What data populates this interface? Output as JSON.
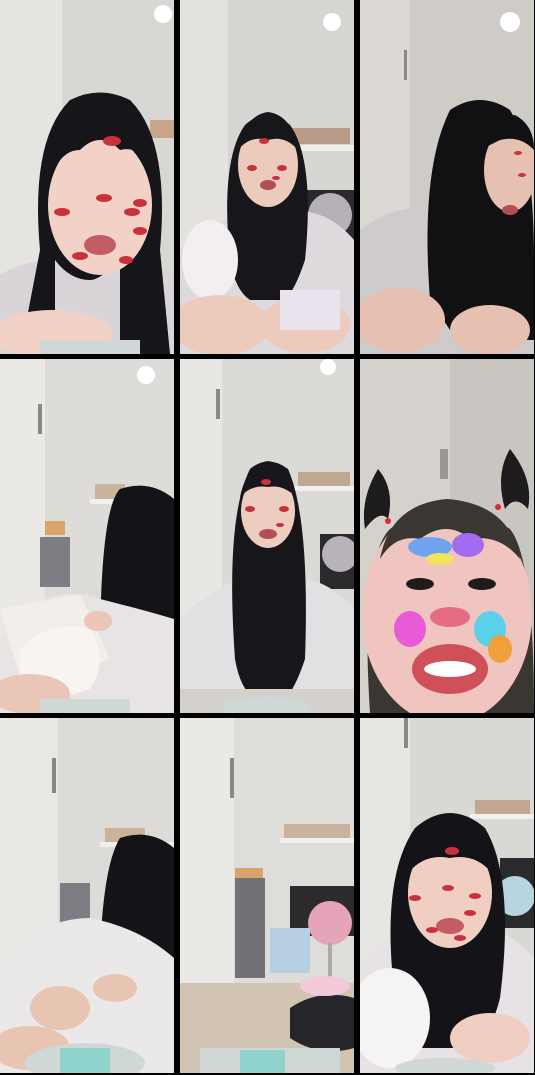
{
  "layout": {
    "rows": 3,
    "cols": 3
  },
  "frames": [
    {
      "id": "frame-1",
      "scene": "closeup",
      "filter": "kiss-marks",
      "wall": "#d9d7d4",
      "skin": "#f2d2c6",
      "shirt": "#d8d4d8"
    },
    {
      "id": "frame-2",
      "scene": "sitting-mid",
      "filter": "kiss-marks",
      "wall": "#d8d6d2",
      "skin": "#eccbbd",
      "shirt": "#ddd9dc"
    },
    {
      "id": "frame-3",
      "scene": "leaning-right",
      "filter": "kiss-marks",
      "wall": "#cfcbc7",
      "skin": "#e6c0b0",
      "shirt": "#cfcbcc"
    },
    {
      "id": "frame-4",
      "scene": "looking-down",
      "filter": "none",
      "wall": "#dedcd9",
      "skin": "#e9c6b6",
      "shirt": "#e8e4e4"
    },
    {
      "id": "frame-5",
      "scene": "sitting-far",
      "filter": "kiss-marks",
      "wall": "#dcdad6",
      "skin": "#edcdbf",
      "shirt": "#e3e0e3"
    },
    {
      "id": "frame-6",
      "scene": "pigtails-closeup",
      "filter": "face-paint",
      "wall": "#c9c6c2",
      "skin": "#f0c5bf",
      "shirt": "#3a3732"
    },
    {
      "id": "frame-7",
      "scene": "hands-down",
      "filter": "none",
      "wall": "#dddbd7",
      "skin": "#e8c4b3",
      "shirt": "#ebe8ea"
    },
    {
      "id": "frame-8",
      "scene": "empty-room",
      "filter": "none",
      "wall": "#dfddd9",
      "skin": "#e5c2b3",
      "shirt": "#cfcfcf"
    },
    {
      "id": "frame-9",
      "scene": "closeup-smile",
      "filter": "kiss-marks",
      "wall": "#dad8d4",
      "skin": "#f0cfc2",
      "shirt": "#e6e2e5"
    }
  ]
}
